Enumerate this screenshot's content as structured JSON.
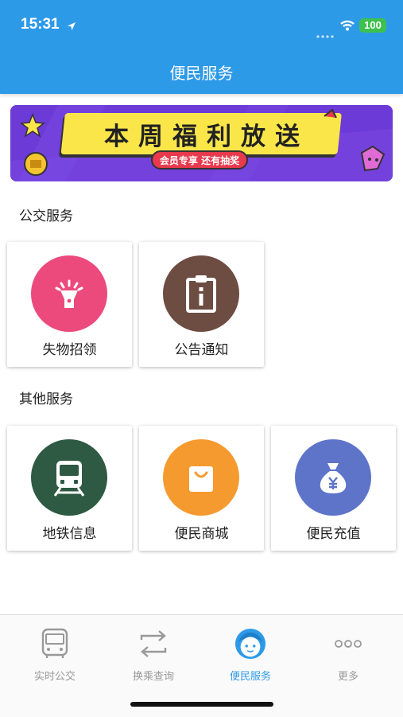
{
  "status_bar": {
    "time": "15:31",
    "battery": "100"
  },
  "header": {
    "title": "便民服务"
  },
  "banner": {
    "title": "本周福利放送",
    "subtitle": "会员专享 还有抽奖"
  },
  "sections": [
    {
      "title": "公交服务",
      "items": [
        {
          "label": "失物招领",
          "icon": "flashlight-icon",
          "color": "#ec4a7d"
        },
        {
          "label": "公告通知",
          "icon": "notice-clipboard-icon",
          "color": "#6d4c41"
        }
      ]
    },
    {
      "title": "其他服务",
      "items": [
        {
          "label": "地铁信息",
          "icon": "subway-icon",
          "color": "#2e5a43"
        },
        {
          "label": "便民商城",
          "icon": "shopping-bag-icon",
          "color": "#f59a2f"
        },
        {
          "label": "便民充值",
          "icon": "money-bag-icon",
          "color": "#5e74c9"
        }
      ]
    }
  ],
  "tabbar": [
    {
      "label": "实时公交",
      "icon": "bus-icon",
      "active": false
    },
    {
      "label": "换乘查询",
      "icon": "transfer-icon",
      "active": false
    },
    {
      "label": "便民服务",
      "icon": "face-icon",
      "active": true
    },
    {
      "label": "更多",
      "icon": "more-dots-icon",
      "active": false
    }
  ],
  "colors": {
    "primary": "#2d9ae8",
    "banner_bg": "#6c3ad6",
    "banner_yellow": "#fbe64a"
  }
}
